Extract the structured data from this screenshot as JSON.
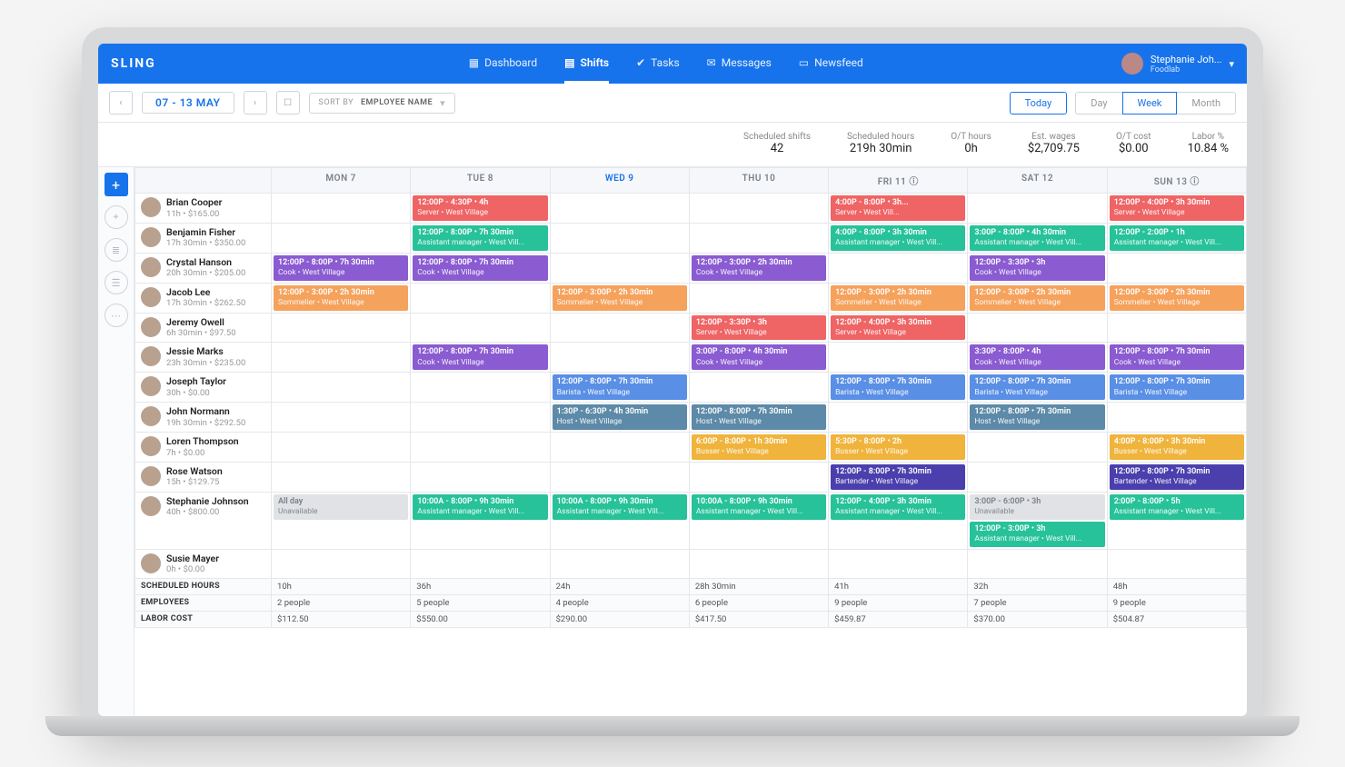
{
  "brand": "SLING",
  "nav": [
    {
      "label": "Dashboard"
    },
    {
      "label": "Shifts",
      "active": true
    },
    {
      "label": "Tasks"
    },
    {
      "label": "Messages"
    },
    {
      "label": "Newsfeed"
    }
  ],
  "user": {
    "name": "Stephanie Joh...",
    "org": "Foodlab"
  },
  "toolbar": {
    "date_range": "07 - 13 MAY",
    "sort_label": "SORT BY",
    "sort_value": "EMPLOYEE NAME",
    "today": "Today",
    "views": [
      "Day",
      "Week",
      "Month"
    ],
    "active_view": "Week"
  },
  "summary": [
    {
      "k": "Scheduled shifts",
      "v": "42"
    },
    {
      "k": "Scheduled hours",
      "v": "219h 30min"
    },
    {
      "k": "O/T hours",
      "v": "0h"
    },
    {
      "k": "Est. wages",
      "v": "$2,709.75"
    },
    {
      "k": "O/T cost",
      "v": "$0.00"
    },
    {
      "k": "Labor %",
      "v": "10.84 %"
    }
  ],
  "days": [
    {
      "label": "MON 7"
    },
    {
      "label": "TUE 8"
    },
    {
      "label": "WED 9",
      "today": true
    },
    {
      "label": "THU 10"
    },
    {
      "label": "FRI 11",
      "info": true
    },
    {
      "label": "SAT 12"
    },
    {
      "label": "SUN 13",
      "info": true
    }
  ],
  "employees": [
    {
      "name": "Brian Cooper",
      "meta": "11h • $165.00",
      "cells": [
        [],
        [
          {
            "c": "c-red",
            "l1": "12:00P - 4:30P • 4h",
            "l2": "Server • West Village"
          }
        ],
        [],
        [],
        [
          {
            "c": "c-red",
            "l1": "4:00P - 8:00P • 3h...",
            "l2": "Server • West Vill..."
          }
        ],
        [],
        [
          {
            "c": "c-red",
            "l1": "12:00P - 4:00P • 3h 30min",
            "l2": "Server • West Village"
          }
        ]
      ]
    },
    {
      "name": "Benjamin Fisher",
      "meta": "17h 30min • $350.00",
      "cells": [
        [],
        [
          {
            "c": "c-teal",
            "l1": "12:00P - 8:00P • 7h 30min",
            "l2": "Assistant manager • West Vill..."
          }
        ],
        [],
        [],
        [
          {
            "c": "c-teal",
            "l1": "4:00P - 8:00P • 3h 30min",
            "l2": "Assistant manager • West Vill..."
          }
        ],
        [
          {
            "c": "c-teal",
            "l1": "3:00P - 8:00P • 4h 30min",
            "l2": "Assistant manager • West Vill..."
          }
        ],
        [
          {
            "c": "c-teal",
            "l1": "12:00P - 2:00P • 1h",
            "l2": "Assistant manager • West Vill..."
          }
        ]
      ]
    },
    {
      "name": "Crystal Hanson",
      "meta": "20h 30min • $205.00",
      "cells": [
        [
          {
            "c": "c-purple",
            "l1": "12:00P - 8:00P • 7h 30min",
            "l2": "Cook • West Village"
          }
        ],
        [
          {
            "c": "c-purple",
            "l1": "12:00P - 8:00P • 7h 30min",
            "l2": "Cook • West Village"
          }
        ],
        [],
        [
          {
            "c": "c-purple",
            "l1": "12:00P - 3:00P • 2h 30min",
            "l2": "Cook • West Village"
          }
        ],
        [],
        [
          {
            "c": "c-purple",
            "l1": "12:00P - 3:30P • 3h",
            "l2": "Cook • West Village"
          }
        ],
        []
      ]
    },
    {
      "name": "Jacob Lee",
      "meta": "17h 30min • $262.50",
      "cells": [
        [
          {
            "c": "c-orange",
            "l1": "12:00P - 3:00P • 2h 30min",
            "l2": "Sommelier • West Village"
          }
        ],
        [],
        [
          {
            "c": "c-orange",
            "l1": "12:00P - 3:00P • 2h 30min",
            "l2": "Sommelier • West Village"
          }
        ],
        [],
        [
          {
            "c": "c-orange",
            "l1": "12:00P - 3:00P • 2h 30min",
            "l2": "Sommelier • West Village"
          }
        ],
        [
          {
            "c": "c-orange",
            "l1": "12:00P - 3:00P • 2h 30min",
            "l2": "Sommelier • West Village"
          }
        ],
        [
          {
            "c": "c-orange",
            "l1": "12:00P - 3:00P • 2h 30min",
            "l2": "Sommelier • West Village"
          }
        ]
      ]
    },
    {
      "name": "Jeremy Owell",
      "meta": "6h 30min • $97.50",
      "cells": [
        [],
        [],
        [],
        [
          {
            "c": "c-red",
            "l1": "12:00P - 3:30P • 3h",
            "l2": "Server • West Village"
          }
        ],
        [
          {
            "c": "c-red",
            "l1": "12:00P - 4:00P • 3h 30min",
            "l2": "Server • West Village"
          }
        ],
        [],
        []
      ]
    },
    {
      "name": "Jessie Marks",
      "meta": "23h 30min • $235.00",
      "cells": [
        [],
        [
          {
            "c": "c-purple",
            "l1": "12:00P - 8:00P • 7h 30min",
            "l2": "Cook • West Village"
          }
        ],
        [],
        [
          {
            "c": "c-purple",
            "l1": "3:00P - 8:00P • 4h 30min",
            "l2": "Cook • West Village"
          }
        ],
        [],
        [
          {
            "c": "c-purple",
            "l1": "3:30P - 8:00P • 4h",
            "l2": "Cook • West Village"
          }
        ],
        [
          {
            "c": "c-purple",
            "l1": "12:00P - 8:00P • 7h 30min",
            "l2": "Cook • West Village"
          }
        ]
      ]
    },
    {
      "name": "Joseph Taylor",
      "meta": "30h • $0.00",
      "cells": [
        [],
        [],
        [
          {
            "c": "c-blue",
            "l1": "12:00P - 8:00P • 7h 30min",
            "l2": "Barista • West Village"
          }
        ],
        [],
        [
          {
            "c": "c-blue",
            "l1": "12:00P - 8:00P • 7h 30min",
            "l2": "Barista • West Village"
          }
        ],
        [
          {
            "c": "c-blue",
            "l1": "12:00P - 8:00P • 7h 30min",
            "l2": "Barista • West Village"
          }
        ],
        [
          {
            "c": "c-blue",
            "l1": "12:00P - 8:00P • 7h 30min",
            "l2": "Barista • West Village"
          }
        ]
      ]
    },
    {
      "name": "John Normann",
      "meta": "19h 30min • $292.50",
      "cells": [
        [],
        [],
        [
          {
            "c": "c-steel",
            "l1": "1:30P - 6:30P • 4h 30min",
            "l2": "Host • West Village"
          }
        ],
        [
          {
            "c": "c-steel",
            "l1": "12:00P - 8:00P • 7h 30min",
            "l2": "Host • West Village"
          }
        ],
        [],
        [
          {
            "c": "c-steel",
            "l1": "12:00P - 8:00P • 7h 30min",
            "l2": "Host • West Village"
          }
        ],
        []
      ]
    },
    {
      "name": "Loren Thompson",
      "meta": "7h • $0.00",
      "cells": [
        [],
        [],
        [],
        [
          {
            "c": "c-gold",
            "l1": "6:00P - 8:00P • 1h 30min",
            "l2": "Busser • West Village"
          }
        ],
        [
          {
            "c": "c-gold",
            "l1": "5:30P - 8:00P • 2h",
            "l2": "Busser • West Village"
          }
        ],
        [],
        [
          {
            "c": "c-gold",
            "l1": "4:00P - 8:00P • 3h 30min",
            "l2": "Busser • West Village"
          }
        ]
      ]
    },
    {
      "name": "Rose Watson",
      "meta": "15h • $129.75",
      "cells": [
        [],
        [],
        [],
        [],
        [
          {
            "c": "c-indigo",
            "l1": "12:00P - 8:00P • 7h 30min",
            "l2": "Bartender • West Village"
          }
        ],
        [],
        [
          {
            "c": "c-indigo",
            "l1": "12:00P - 8:00P • 7h 30min",
            "l2": "Bartender • West Village"
          }
        ]
      ]
    },
    {
      "name": "Stephanie Johnson",
      "meta": "40h • $800.00",
      "cells": [
        [
          {
            "c": "unavail",
            "l1": "All day",
            "l2": "Unavailable"
          }
        ],
        [
          {
            "c": "c-teal",
            "l1": "10:00A - 8:00P • 9h 30min",
            "l2": "Assistant manager • West Vill..."
          }
        ],
        [
          {
            "c": "c-teal",
            "l1": "10:00A - 8:00P • 9h 30min",
            "l2": "Assistant manager • West Vill..."
          }
        ],
        [
          {
            "c": "c-teal",
            "l1": "10:00A - 8:00P • 9h 30min",
            "l2": "Assistant manager • West Vill..."
          }
        ],
        [
          {
            "c": "c-teal",
            "l1": "12:00P - 4:00P • 3h 30min",
            "l2": "Assistant manager • West Vill..."
          }
        ],
        [
          {
            "c": "unavail",
            "l1": "3:00P - 6:00P • 3h",
            "l2": "Unavailable"
          },
          {
            "c": "c-teal",
            "l1": "12:00P - 3:00P • 3h",
            "l2": "Assistant manager • West Vill..."
          }
        ],
        [
          {
            "c": "c-teal",
            "l1": "2:00P - 8:00P • 5h",
            "l2": "Assistant manager • West Vill..."
          }
        ]
      ]
    },
    {
      "name": "Susie Mayer",
      "meta": "0h • $0.00",
      "cells": [
        [],
        [],
        [],
        [],
        [],
        [],
        []
      ]
    }
  ],
  "footer": {
    "labels": [
      "SCHEDULED HOURS",
      "EMPLOYEES",
      "LABOR COST"
    ],
    "cols": [
      [
        "10h",
        "2 people",
        "$112.50"
      ],
      [
        "36h",
        "5 people",
        "$550.00"
      ],
      [
        "24h",
        "4 people",
        "$290.00"
      ],
      [
        "28h 30min",
        "6 people",
        "$417.50"
      ],
      [
        "41h",
        "9 people",
        "$459.87"
      ],
      [
        "32h",
        "7 people",
        "$370.00"
      ],
      [
        "48h",
        "9 people",
        "$504.87"
      ]
    ]
  }
}
